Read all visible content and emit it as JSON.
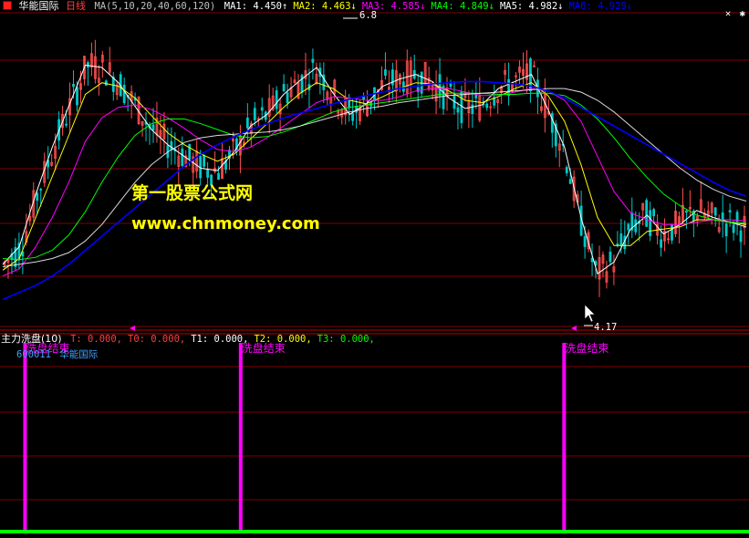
{
  "window": {
    "stock_name": "华能国际",
    "period": "日线",
    "stock_code": "600011",
    "controls": [
      "✕",
      "✱"
    ]
  },
  "top_legend": {
    "indicator": "MA(5,10,20,40,60,120)",
    "items": [
      {
        "label": "MA1:",
        "value": "4.450",
        "arrow": "↑",
        "color": "#ffffff"
      },
      {
        "label": "MA2:",
        "value": "4.463",
        "arrow": "↓",
        "color": "#ffff00"
      },
      {
        "label": "MA3:",
        "value": "4.585",
        "arrow": "↓",
        "color": "#ff00ff"
      },
      {
        "label": "MA4:",
        "value": "4.849",
        "arrow": "↓",
        "color": "#00ff00"
      },
      {
        "label": "MA5:",
        "value": "4.982",
        "arrow": "↓",
        "color": "#ffffff"
      },
      {
        "label": "MA6:",
        "value": "4.929",
        "arrow": "↓",
        "color": "#0000ff"
      }
    ]
  },
  "watermark": {
    "line1": "第一股票公式网",
    "line2": "www.chnmoney.com",
    "color": "#ffff00"
  },
  "price_panel": {
    "high_label": "6.8",
    "low_label": "4.17"
  },
  "sub_panel": {
    "title": "主力洗盘(10)",
    "items": [
      {
        "label": "T:",
        "value": "0.000,",
        "color": "#ff4040"
      },
      {
        "label": "T0:",
        "value": "0.000,",
        "color": "#ff4040"
      },
      {
        "label": "T1:",
        "value": "0.000,",
        "color": "#ffffff"
      },
      {
        "label": "T2:",
        "value": "0.000,",
        "color": "#ffff00"
      },
      {
        "label": "T3:",
        "value": "0.000,",
        "color": "#00ff00"
      }
    ],
    "signal_label": "洗盘结束"
  },
  "colors": {
    "grid": "#800000",
    "up_candle": "#ff5050",
    "down_candle": "#00c8c8",
    "signal": "#ff00ff",
    "zero_line": "#00ff00"
  },
  "chart_data": {
    "type": "candlestick",
    "price_range": [
      4.17,
      6.8
    ],
    "ma_periods": [
      5,
      10,
      20,
      40,
      60,
      120
    ],
    "series": [
      {
        "name": "MA1",
        "color": "#ffffff",
        "values": [
          4.7,
          4.85,
          5.3,
          5.7,
          6.05,
          6.4,
          6.38,
          6.25,
          6.05,
          5.85,
          5.72,
          5.62,
          5.52,
          5.5,
          5.66,
          5.88,
          5.98,
          6.15,
          6.27,
          6.38,
          6.16,
          5.98,
          6.07,
          6.22,
          6.28,
          6.32,
          6.26,
          6.12,
          6.03,
          6.06,
          6.2,
          6.26,
          6.32,
          6.02,
          5.7,
          5.1,
          4.62,
          4.72,
          5.0,
          5.12,
          4.96,
          5.04,
          5.16,
          5.1,
          5.06,
          5.02
        ]
      },
      {
        "name": "MA2",
        "color": "#ffff00",
        "values": [
          4.65,
          4.75,
          5.1,
          5.45,
          5.8,
          6.15,
          6.25,
          6.22,
          6.12,
          5.97,
          5.82,
          5.72,
          5.64,
          5.58,
          5.64,
          5.77,
          5.9,
          6.04,
          6.16,
          6.25,
          6.2,
          6.1,
          6.07,
          6.13,
          6.2,
          6.25,
          6.24,
          6.18,
          6.1,
          6.08,
          6.13,
          6.2,
          6.25,
          6.14,
          5.92,
          5.55,
          5.1,
          4.86,
          4.86,
          4.98,
          5.0,
          5.02,
          5.08,
          5.08,
          5.06,
          5.04
        ]
      },
      {
        "name": "MA3",
        "color": "#ff00ff",
        "values": [
          4.6,
          4.66,
          4.85,
          5.1,
          5.4,
          5.75,
          5.95,
          6.04,
          6.06,
          6.02,
          5.95,
          5.86,
          5.76,
          5.68,
          5.66,
          5.7,
          5.78,
          5.88,
          5.98,
          6.08,
          6.13,
          6.12,
          6.1,
          6.1,
          6.13,
          6.18,
          6.2,
          6.2,
          6.17,
          6.14,
          6.14,
          6.17,
          6.2,
          6.18,
          6.1,
          5.92,
          5.62,
          5.32,
          5.14,
          5.08,
          5.04,
          5.04,
          5.06,
          5.08,
          5.08,
          5.07
        ]
      },
      {
        "name": "MA4",
        "color": "#00ff00",
        "values": [
          4.75,
          4.74,
          4.76,
          4.82,
          4.95,
          5.15,
          5.4,
          5.62,
          5.8,
          5.9,
          5.94,
          5.94,
          5.9,
          5.85,
          5.8,
          5.78,
          5.79,
          5.83,
          5.88,
          5.94,
          6.0,
          6.04,
          6.06,
          6.08,
          6.1,
          6.12,
          6.14,
          6.16,
          6.16,
          6.16,
          6.15,
          6.15,
          6.16,
          6.16,
          6.14,
          6.06,
          5.94,
          5.78,
          5.6,
          5.44,
          5.3,
          5.2,
          5.12,
          5.08,
          5.06,
          5.05
        ]
      },
      {
        "name": "MA5",
        "color": "#ffffff",
        "values": [
          4.68,
          4.7,
          4.72,
          4.75,
          4.8,
          4.9,
          5.04,
          5.22,
          5.4,
          5.55,
          5.66,
          5.74,
          5.78,
          5.8,
          5.81,
          5.82,
          5.83,
          5.85,
          5.88,
          5.92,
          5.96,
          6.0,
          6.03,
          6.05,
          6.08,
          6.1,
          6.12,
          6.14,
          6.15,
          6.16,
          6.17,
          6.18,
          6.19,
          6.2,
          6.2,
          6.17,
          6.1,
          6.0,
          5.88,
          5.76,
          5.64,
          5.52,
          5.42,
          5.34,
          5.28,
          5.24
        ]
      },
      {
        "name": "MA6",
        "color": "#0000ff",
        "values": [
          4.4,
          4.46,
          4.52,
          4.6,
          4.7,
          4.82,
          4.94,
          5.06,
          5.18,
          5.3,
          5.42,
          5.54,
          5.64,
          5.72,
          5.79,
          5.85,
          5.9,
          5.95,
          5.99,
          6.03,
          6.07,
          6.11,
          6.14,
          6.17,
          6.2,
          6.22,
          6.24,
          6.25,
          6.26,
          6.26,
          6.25,
          6.24,
          6.22,
          6.18,
          6.12,
          6.04,
          5.96,
          5.88,
          5.8,
          5.72,
          5.64,
          5.56,
          5.48,
          5.4,
          5.33,
          5.28
        ]
      }
    ],
    "signal": {
      "name": "洗盘结束",
      "positions": [
        0.03,
        0.32,
        0.755
      ]
    }
  }
}
